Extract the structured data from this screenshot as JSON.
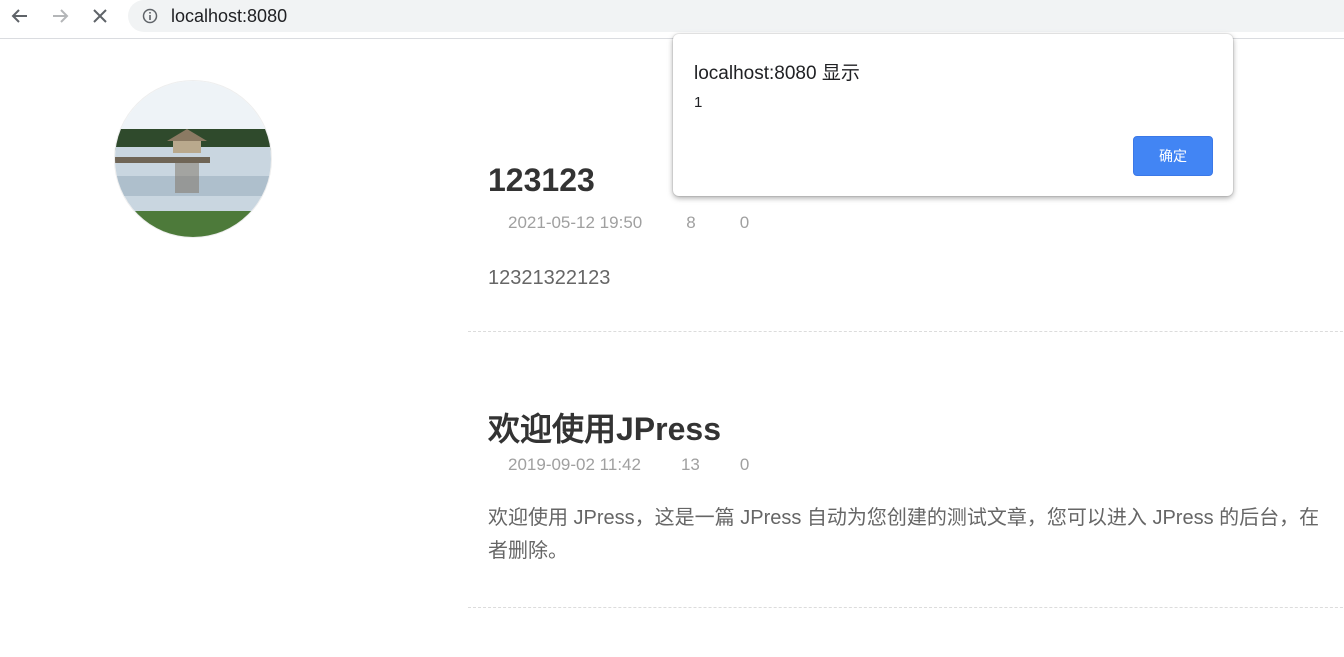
{
  "browser": {
    "url": "localhost:8080",
    "icons": {
      "back": "arrow-left-icon",
      "forward": "arrow-right-icon",
      "stop": "close-icon",
      "site_info": "info-icon"
    }
  },
  "sidebar": {
    "avatar": "avatar-image"
  },
  "posts": [
    {
      "title": "123123",
      "date": "2021-05-12 19:50",
      "views": "8",
      "comments": "0",
      "excerpt": "12321322123"
    },
    {
      "title": "欢迎使用JPress",
      "date": "2019-09-02 11:42",
      "views": "13",
      "comments": "0",
      "excerpt_line1": "欢迎使用 JPress，这是一篇 JPress 自动为您创建的测试文章，您可以进入 JPress 的后台，在",
      "excerpt_line2": "者删除。"
    }
  ],
  "dialog": {
    "title": "localhost:8080 显示",
    "message": "1",
    "ok_label": "确定",
    "accent": "#4285f4"
  }
}
